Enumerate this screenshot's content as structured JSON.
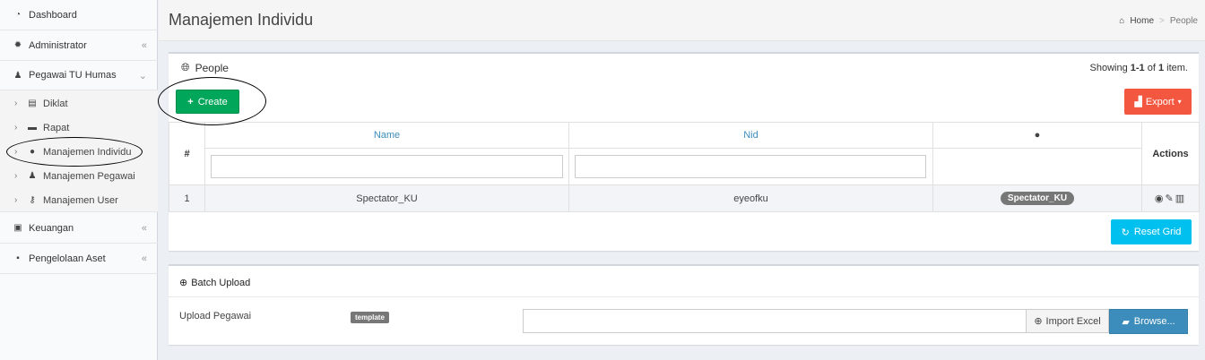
{
  "sidebar": {
    "dashboard": "Dashboard",
    "administrator": "Administrator",
    "pegawai": "Pegawai TU Humas",
    "sub_items": [
      "Diklat",
      "Rapat",
      "Manajemen Individu",
      "Manajemen Pegawai",
      "Manajemen User"
    ],
    "keuangan": "Keuangan",
    "aset": "Pengelolaan Aset",
    "collapse_arrow": "«",
    "expand_arrow": "»"
  },
  "header": {
    "title": "Manajemen Individu",
    "breadcrumb_home": "Home",
    "breadcrumb_sep": ">",
    "breadcrumb_current": "People"
  },
  "box": {
    "title": "People",
    "showing_prefix": "Showing ",
    "showing_range": "1-1",
    "showing_mid": " of ",
    "showing_total": "1",
    "showing_suffix": " item.",
    "create_label": "Create",
    "export_label": "Export",
    "reset_label": "Reset Grid"
  },
  "table": {
    "col_num": "#",
    "col_name": "Name",
    "col_nid": "Nid",
    "col_actions": "Actions",
    "rows": [
      {
        "num": "1",
        "name": "Spectator_KU",
        "nid": "eyeofku",
        "role": "Spectator_KU"
      }
    ]
  },
  "batch": {
    "title": "Batch Upload",
    "upload_label": "Upload Pegawai",
    "template_label": "template",
    "import_label": "Import Excel",
    "browse_label": "Browse..."
  },
  "colors": {
    "create": "#00a65a",
    "export": "#f3573f",
    "reset": "#00c0ef",
    "browse": "#3c8dbc",
    "link": "#3c8dbc"
  }
}
